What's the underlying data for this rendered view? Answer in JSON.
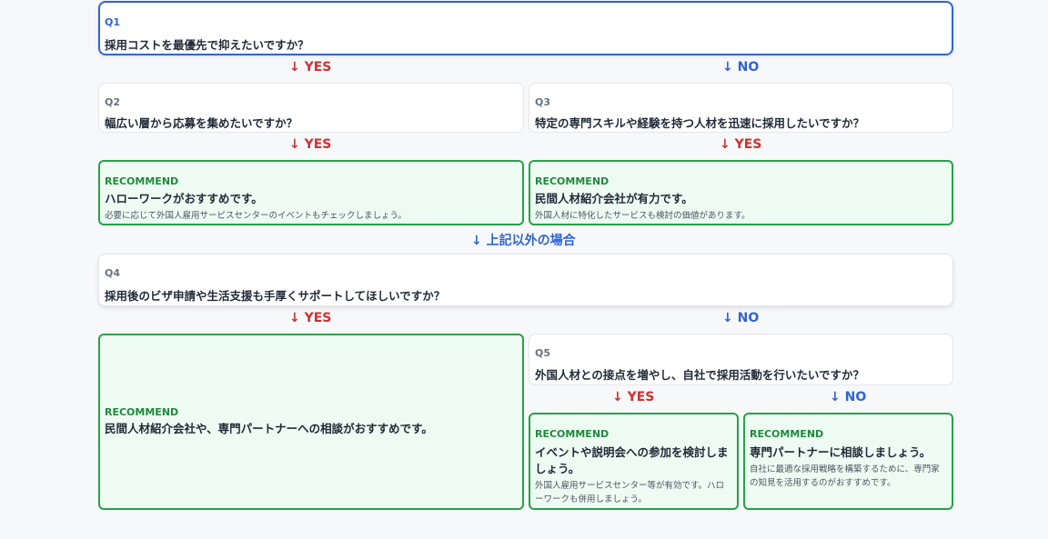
{
  "colors": {
    "yes": "#d32f2f",
    "no": "#2f64d6",
    "recommend_border": "#27a14a",
    "recommend_bg": "#eefbf2",
    "active_border": "#2f64d6"
  },
  "arrow_icon": "↓",
  "q1": {
    "label": "Q1",
    "text": "採用コストを最優先で抑えたいですか？"
  },
  "q1_yes": "YES",
  "q1_no": "NO",
  "q2": {
    "label": "Q2",
    "text": "幅広い層から応募を集めたいですか？"
  },
  "q3": {
    "label": "Q3",
    "text": "特定の専門スキルや経験を持つ人材を迅速に採用したいですか？"
  },
  "q2_yes": "YES",
  "q3_yes": "YES",
  "rec1": {
    "label": "RECOMMEND",
    "title": "ハローワークがおすすめです。",
    "note": "必要に応じて外国人雇用サービスセンターのイベントもチェックしましょう。"
  },
  "rec2": {
    "label": "RECOMMEND",
    "title": "民間人材紹介会社が有力です。",
    "note": "外国人材に特化したサービスも検討の価値があります。"
  },
  "otherwise": "上記以外の場合",
  "q4": {
    "label": "Q4",
    "text": "採用後のビザ申請や生活支援も手厚くサポートしてほしいですか？"
  },
  "q4_yes": "YES",
  "q4_no": "NO",
  "rec3": {
    "label": "RECOMMEND",
    "title": "民間人材紹介会社や、専門パートナーへの相談がおすすめです。"
  },
  "q5": {
    "label": "Q5",
    "text": "外国人材との接点を増やし、自社で採用活動を行いたいですか？"
  },
  "q5_yes": "YES",
  "q5_no": "NO",
  "rec4": {
    "label": "RECOMMEND",
    "title": "イベントや説明会への参加を検討しましょう。",
    "note": "外国人雇用サービスセンター等が有効です。ハローワークも併用しましょう。"
  },
  "rec5": {
    "label": "RECOMMEND",
    "title": "専門パートナーに相談しましょう。",
    "note": "自社に最適な採用戦略を構築するために、専門家の知見を活用するのがおすすめです。"
  }
}
